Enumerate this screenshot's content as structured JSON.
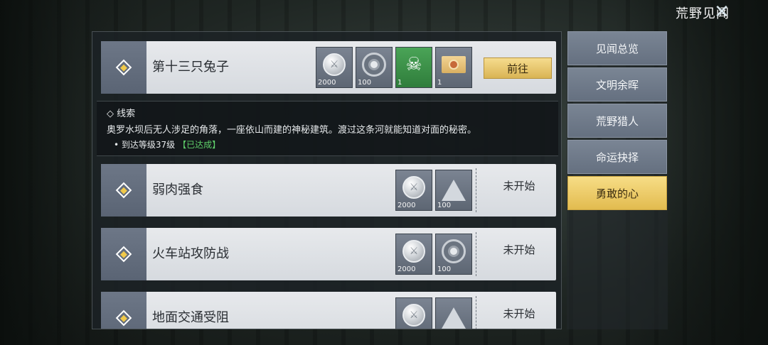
{
  "header": {
    "title": "荒野见闻",
    "close_icon": "close-icon"
  },
  "quests": [
    {
      "name": "第十三只兔子",
      "rewards": [
        {
          "icon": "coin-icon",
          "amount": "2000",
          "color": "gray"
        },
        {
          "icon": "xp-target-icon",
          "amount": "100",
          "color": "gray"
        },
        {
          "icon": "skull-icon",
          "amount": "1",
          "color": "green"
        },
        {
          "icon": "envelope-icon",
          "amount": "1",
          "color": "gray"
        }
      ],
      "action": "前往"
    },
    {
      "name": "弱肉强食",
      "rewards": [
        {
          "icon": "coin-icon",
          "amount": "2000"
        },
        {
          "icon": "rank-icon",
          "amount": "100"
        }
      ],
      "status": "未开始"
    },
    {
      "name": "火车站攻防战",
      "rewards": [
        {
          "icon": "coin-icon",
          "amount": "2000"
        },
        {
          "icon": "xp-target-icon",
          "amount": "100"
        }
      ],
      "status": "未开始"
    },
    {
      "name": "地面交通受阻",
      "rewards": [
        {
          "icon": "coin-icon",
          "amount": ""
        },
        {
          "icon": "rank-icon",
          "amount": ""
        }
      ],
      "status": "未开始"
    }
  ],
  "clue": {
    "title": "◇ 线索",
    "description": "奥罗水坝后无人涉足的角落，一座依山而建的神秘建筑。渡过这条河就能知道对面的秘密。",
    "requirement": "• 到达等级37级",
    "requirement_status": "【已达成】"
  },
  "tabs": [
    {
      "label": "见闻总览",
      "active": false
    },
    {
      "label": "文明余晖",
      "active": false
    },
    {
      "label": "荒野猎人",
      "active": false
    },
    {
      "label": "命运抉择",
      "active": false
    },
    {
      "label": "勇敢的心",
      "active": true
    }
  ],
  "colors": {
    "accent": "#e2bb4f",
    "done": "#5fd06a",
    "card": "#dfe2e6"
  }
}
